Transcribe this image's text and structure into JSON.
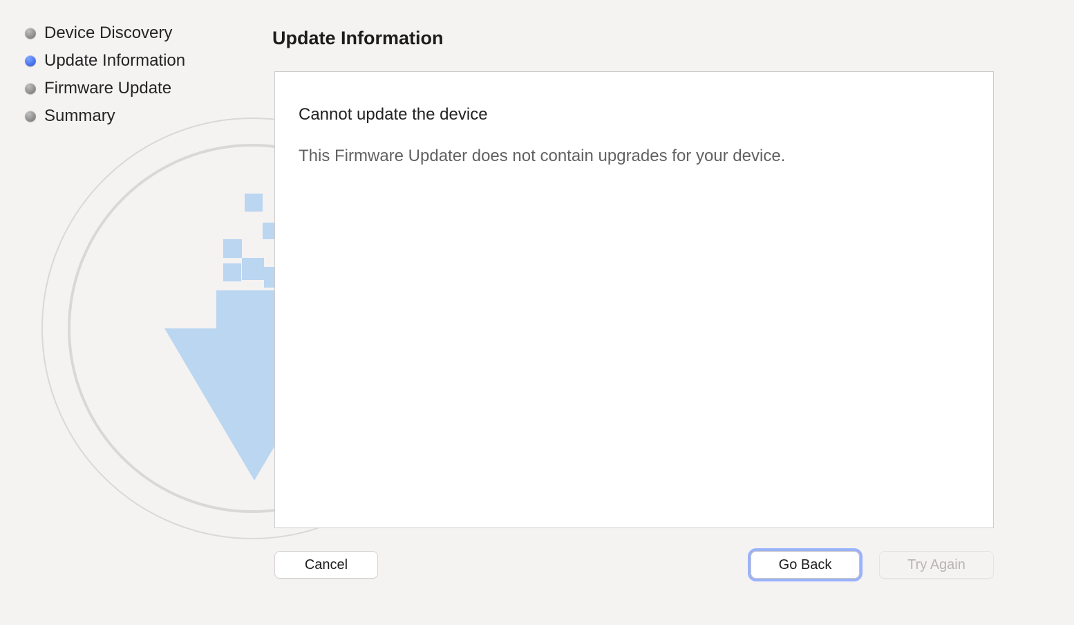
{
  "sidebar": {
    "steps": [
      {
        "label": "Device Discovery",
        "active": false
      },
      {
        "label": "Update Information",
        "active": true
      },
      {
        "label": "Firmware Update",
        "active": false
      },
      {
        "label": "Summary",
        "active": false
      }
    ]
  },
  "page": {
    "title": "Update Information"
  },
  "content": {
    "heading": "Cannot update the device",
    "body": "This Firmware Updater does not contain upgrades for your device."
  },
  "buttons": {
    "cancel": "Cancel",
    "go_back": "Go Back",
    "try_again": "Try Again"
  }
}
